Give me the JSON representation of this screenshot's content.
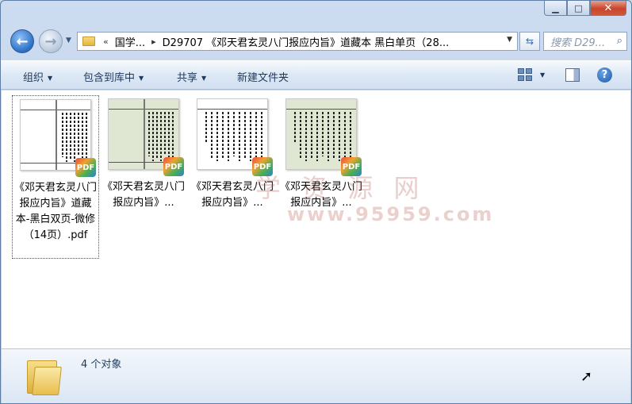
{
  "window": {
    "minimize_label": "▁",
    "maximize_label": "□",
    "close_label": "✕"
  },
  "nav": {
    "back_glyph": "←",
    "forward_glyph": "→",
    "address_segments": [
      "国学...",
      "D29707 《邓天君玄灵八门报应内旨》道藏本 黑白单页（28..."
    ],
    "address_prefix": "«",
    "search_placeholder": "搜索 D29..."
  },
  "toolbar": {
    "organize": "组织",
    "include_in_library": "包含到库中",
    "share": "共享",
    "new_folder": "新建文件夹"
  },
  "files": [
    {
      "label": "《邓天君玄灵八门报应内旨》道藏本-黑白双页-微修（14页）.pdf",
      "badge": "PDF",
      "style": "bw-double",
      "selected": true
    },
    {
      "label": "《邓天君玄灵八门报应内旨》...",
      "badge": "PDF",
      "style": "green-double",
      "selected": false
    },
    {
      "label": "《邓天君玄灵八门报应内旨》...",
      "badge": "PDF",
      "style": "bw-single",
      "selected": false
    },
    {
      "label": "《邓天君玄灵八门报应内旨》...",
      "badge": "PDF",
      "style": "green-single",
      "selected": false
    }
  ],
  "watermark": {
    "text": "学 资 源 网",
    "url": "www.95959.com"
  },
  "status": {
    "count": "4 个对象"
  }
}
